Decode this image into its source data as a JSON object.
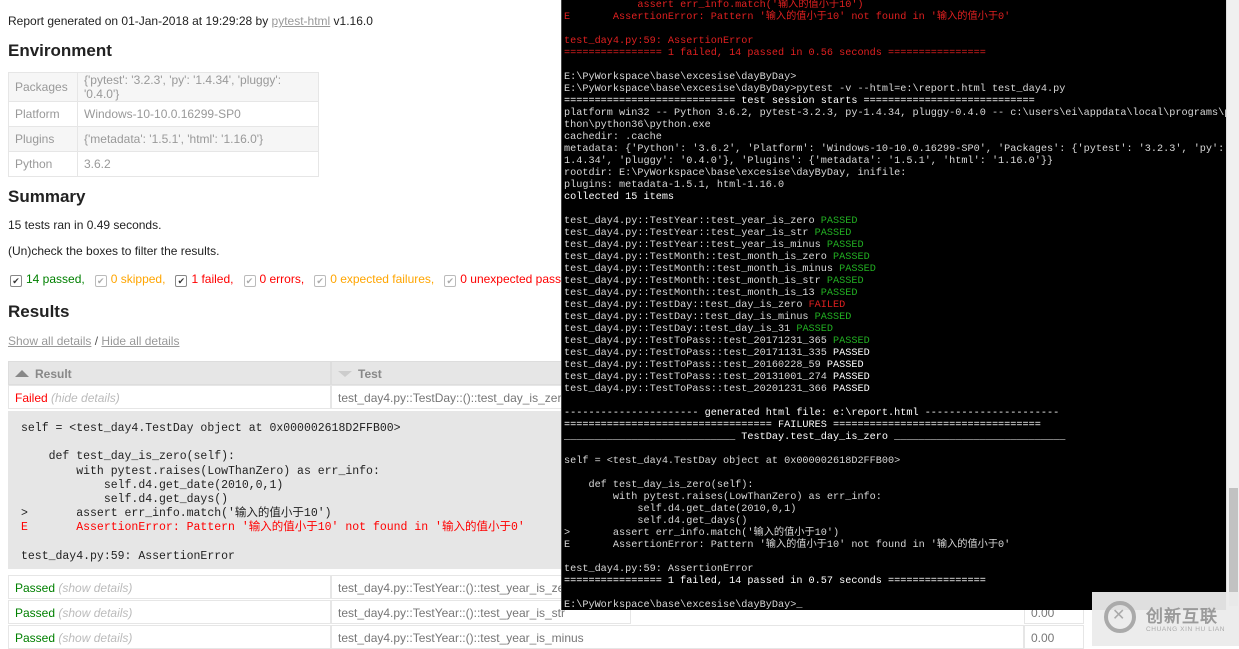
{
  "report": {
    "generated_prefix": "Report generated on 01-Jan-2018 at 19:29:28 by ",
    "generated_link": "pytest-html",
    "generated_suffix": " v1.16.0",
    "environment_heading": "Environment",
    "environment": [
      {
        "key": "Packages",
        "value": "{'pytest': '3.2.3', 'py': '1.4.34', 'pluggy': '0.4.0'}"
      },
      {
        "key": "Platform",
        "value": "Windows-10-10.0.16299-SP0"
      },
      {
        "key": "Plugins",
        "value": "{'metadata': '1.5.1', 'html': '1.16.0'}"
      },
      {
        "key": "Python",
        "value": "3.6.2"
      }
    ],
    "summary_heading": "Summary",
    "summary_line": "15 tests ran in 0.49 seconds.",
    "filter_hint": "(Un)check the boxes to filter the results.",
    "filters": {
      "passed": "14 passed,",
      "skipped": "0 skipped,",
      "failed": "1 failed,",
      "errors": "0 errors,",
      "xfail": "0 expected failures,",
      "xpass": "0 unexpected passes"
    },
    "results_heading": "Results",
    "show_all": "Show all details",
    "separator": " / ",
    "hide_all": "Hide all details",
    "columns": {
      "result": "Result",
      "test": "Test"
    },
    "rows": [
      {
        "result": "Failed",
        "hint": "(hide details)",
        "test": "test_day4.py::TestDay::()::test_day_is_zero",
        "duration": ""
      },
      {
        "result": "Passed",
        "hint": "(show details)",
        "test": "test_day4.py::TestYear::()::test_year_is_zero",
        "duration": ""
      },
      {
        "result": "Passed",
        "hint": "(show details)",
        "test": "test_day4.py::TestYear::()::test_year_is_str",
        "duration": "0.00"
      },
      {
        "result": "Passed",
        "hint": "(show details)",
        "test": "test_day4.py::TestYear::()::test_year_is_minus",
        "duration": "0.00"
      }
    ],
    "log": {
      "lines": [
        "self = <test_day4.TestDay object at 0x000002618D2FFB00>",
        "",
        "    def test_day_is_zero(self):",
        "        with pytest.raises(LowThanZero) as err_info:",
        "            self.d4.get_date(2010,0,1)",
        "            self.d4.get_days()",
        ">       assert err_info.match('输入的值小于10')"
      ],
      "error_line": "E       AssertionError: Pattern '输入的值小于10' not found in '输入的值小于0'",
      "footer": "test_day4.py:59: AssertionError"
    }
  },
  "terminal": {
    "top_lines": [
      {
        "text": "            assert err_info.match('输入的值小于10')",
        "color": "red"
      },
      {
        "text": "E       AssertionError: Pattern '输入的值小于10' not found in '输入的值小于0'",
        "color": "red"
      },
      {
        "text": "",
        "color": ""
      },
      {
        "text": "test_day4.py:59: AssertionError",
        "color": "red"
      },
      {
        "text": "================ 1 failed, 14 passed in 0.56 seconds ================",
        "color": "red"
      },
      {
        "text": "",
        "color": ""
      },
      {
        "text": "E:\\PyWorkspace\\base\\excesise\\dayByDay>",
        "color": ""
      },
      {
        "text": "E:\\PyWorkspace\\base\\excesise\\dayByDay>pytest -v --html=e:\\report.html test_day4.py",
        "color": ""
      },
      {
        "text": "============================ test session starts ============================",
        "color": "white"
      },
      {
        "text": "platform win32 -- Python 3.6.2, pytest-3.2.3, py-1.4.34, pluggy-0.4.0 -- c:\\users\\ei\\appdata\\local\\programs\\py",
        "color": ""
      },
      {
        "text": "thon\\python36\\python.exe",
        "color": ""
      },
      {
        "text": "cachedir: .cache",
        "color": ""
      },
      {
        "text": "metadata: {'Python': '3.6.2', 'Platform': 'Windows-10-10.0.16299-SP0', 'Packages': {'pytest': '3.2.3', 'py': '",
        "color": ""
      },
      {
        "text": "1.4.34', 'pluggy': '0.4.0'}, 'Plugins': {'metadata': '1.5.1', 'html': '1.16.0'}}",
        "color": ""
      },
      {
        "text": "rootdir: E:\\PyWorkspace\\base\\excesise\\dayByDay, inifile:",
        "color": ""
      },
      {
        "text": "plugins: metadata-1.5.1, html-1.16.0",
        "color": ""
      },
      {
        "text": "collected 15 items",
        "color": "white"
      },
      {
        "text": "",
        "color": ""
      }
    ],
    "tests": [
      {
        "name": "test_day4.py::TestYear::test_year_is_zero",
        "status": "PASSED",
        "color": "green"
      },
      {
        "name": "test_day4.py::TestYear::test_year_is_str",
        "status": "PASSED",
        "color": "green"
      },
      {
        "name": "test_day4.py::TestYear::test_year_is_minus",
        "status": "PASSED",
        "color": "green"
      },
      {
        "name": "test_day4.py::TestMonth::test_month_is_zero",
        "status": "PASSED",
        "color": "green"
      },
      {
        "name": "test_day4.py::TestMonth::test_month_is_minus",
        "status": "PASSED",
        "color": "green"
      },
      {
        "name": "test_day4.py::TestMonth::test_month_is_str",
        "status": "PASSED",
        "color": "green"
      },
      {
        "name": "test_day4.py::TestMonth::test_month_is_13",
        "status": "PASSED",
        "color": "green"
      },
      {
        "name": "test_day4.py::TestDay::test_day_is_zero",
        "status": "FAILED",
        "color": "red"
      },
      {
        "name": "test_day4.py::TestDay::test_day_is_minus",
        "status": "PASSED",
        "color": "green"
      },
      {
        "name": "test_day4.py::TestDay::test_day_is_31",
        "status": "PASSED",
        "color": "green"
      },
      {
        "name": "test_day4.py::TestToPass::test_20171231_365",
        "status": "PASSED",
        "color": "green"
      },
      {
        "name": "test_day4.py::TestToPass::test_20171131_335",
        "status": "PASSED",
        "color": "white"
      },
      {
        "name": "test_day4.py::TestToPass::test_20160228_59",
        "status": "PASSED",
        "color": "white"
      },
      {
        "name": "test_day4.py::TestToPass::test_20131001_274",
        "status": "PASSED",
        "color": "white"
      },
      {
        "name": "test_day4.py::TestToPass::test_20201231_366",
        "status": "PASSED",
        "color": "white"
      }
    ],
    "bottom_lines": [
      {
        "text": "",
        "color": ""
      },
      {
        "text": "---------------------- generated html file: e:\\report.html ----------------------",
        "color": "white"
      },
      {
        "text": "================================== FAILURES ==================================",
        "color": "white"
      },
      {
        "text": "____________________________ TestDay.test_day_is_zero ____________________________",
        "color": "white"
      },
      {
        "text": "",
        "color": ""
      },
      {
        "text": "self = <test_day4.TestDay object at 0x000002618D2FFB00>",
        "color": ""
      },
      {
        "text": "",
        "color": ""
      },
      {
        "text": "    def test_day_is_zero(self):",
        "color": ""
      },
      {
        "text": "        with pytest.raises(LowThanZero) as err_info:",
        "color": ""
      },
      {
        "text": "            self.d4.get_date(2010,0,1)",
        "color": ""
      },
      {
        "text": "            self.d4.get_days()",
        "color": ""
      },
      {
        "text": ">       assert err_info.match('输入的值小于10')",
        "color": ""
      },
      {
        "text": "E       AssertionError: Pattern '输入的值小于10' not found in '输入的值小于0'",
        "color": ""
      },
      {
        "text": "",
        "color": ""
      },
      {
        "text": "test_day4.py:59: AssertionError",
        "color": ""
      },
      {
        "text": "================ 1 failed, 14 passed in 0.57 seconds ================",
        "color": "white"
      },
      {
        "text": "",
        "color": ""
      },
      {
        "text": "E:\\PyWorkspace\\base\\excesise\\dayByDay>_",
        "color": ""
      }
    ]
  },
  "watermark": {
    "cn": "创新互联",
    "en": "CHUANG XIN HU LIAN"
  },
  "colors": {
    "passed": "#008000",
    "failed": "#ff0000",
    "skipped": "#ffa500",
    "terminal_bg": "#000000"
  }
}
